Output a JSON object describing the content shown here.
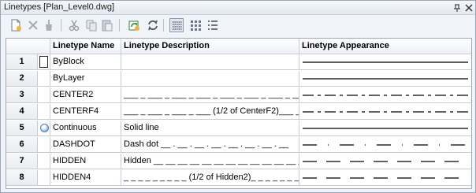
{
  "window": {
    "title": "Linetypes [Plan_Level0.dwg]"
  },
  "toolbar": {
    "buttons": [
      {
        "name": "new-icon"
      },
      {
        "name": "delete-icon"
      },
      {
        "name": "purge-icon"
      },
      {
        "name": "cut-icon"
      },
      {
        "name": "copy-icon"
      },
      {
        "name": "paste-icon"
      },
      {
        "name": "load-icon"
      },
      {
        "name": "refresh-icon"
      },
      {
        "name": "details-view-icon"
      },
      {
        "name": "icon-view-icon"
      },
      {
        "name": "list-view-icon"
      }
    ]
  },
  "grid": {
    "headers": {
      "name": "Linetype Name",
      "description": "Linetype Description",
      "appearance": "Linetype Appearance"
    },
    "rows": [
      {
        "num": "1",
        "name": "ByBlock",
        "description": "",
        "pattern": "solid",
        "marker": "selected"
      },
      {
        "num": "2",
        "name": "ByLayer",
        "description": "",
        "pattern": "solid",
        "marker": ""
      },
      {
        "num": "3",
        "name": "CENTER2",
        "description": "___ _ ___ _ ___ _ ___ _ ___ _ ___ _ ___ _ ___ _",
        "pattern": "center",
        "marker": ""
      },
      {
        "num": "4",
        "name": "CENTERF4",
        "description": "___ _ ___ _ ___ _ ___ (1/2 of CenterF2)___ _ ___",
        "pattern": "center",
        "marker": ""
      },
      {
        "num": "5",
        "name": "Continuous",
        "description": "Solid line",
        "pattern": "solid",
        "marker": "current"
      },
      {
        "num": "6",
        "name": "DASHDOT",
        "description": "Dash dot __ . __ . __ . __ . __ . __ . __ . __",
        "pattern": "dashdot",
        "marker": ""
      },
      {
        "num": "7",
        "name": "HIDDEN",
        "description": "Hidden __ __ __ __ __ __ __ __ __ __ __ __ __ __ __",
        "pattern": "hidden",
        "marker": ""
      },
      {
        "num": "8",
        "name": "HIDDEN4",
        "description": "_ _ _ _ _ _ _ _ _ (1/2 of Hidden2)_ _ _ _ _ _ _",
        "pattern": "hidden",
        "marker": ""
      }
    ]
  }
}
